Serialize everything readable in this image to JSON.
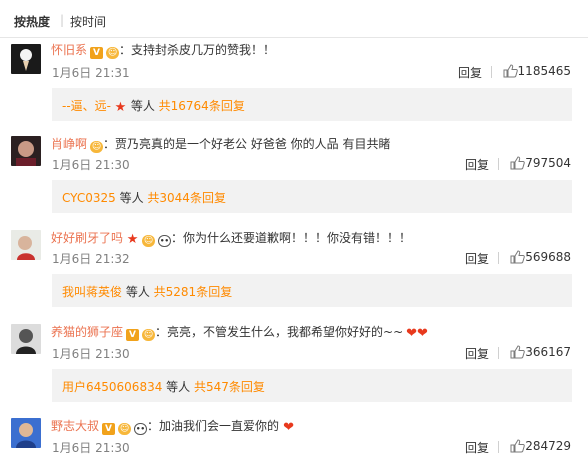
{
  "sort": {
    "hot": "按热度",
    "sep": "|",
    "time": "按时间"
  },
  "comments": [
    {
      "user": "怀旧系",
      "text": "：支持封杀皮几万的赞我！！",
      "time": "1月6日 21:31",
      "reply": "回复",
      "likes": "1185465",
      "sub": {
        "users": "--逼、远-",
        "mid": " 等人 ",
        "total": "共16764条回复"
      }
    },
    {
      "user": "肖峥啊",
      "text": "：贾乃亮真的是一个好老公 好爸爸 你的人品 有目共睹",
      "time": "1月6日 21:30",
      "reply": "回复",
      "likes": "797504",
      "sub": {
        "users": "CYC0325",
        "mid": " 等人 ",
        "total": "共3044条回复"
      }
    },
    {
      "user": "好好刷牙了吗",
      "text": "：你为什么还要道歉啊！！！你没有错！！！",
      "time": "1月6日 21:32",
      "reply": "回复",
      "likes": "569688",
      "sub": {
        "users": "我叫蒋英俊",
        "mid": " 等人 ",
        "total": "共5281条回复"
      }
    },
    {
      "user": "养猫的狮子座",
      "text": "：亮亮，不管发生什么，我都希望你好好的~~",
      "time": "1月6日 21:30",
      "reply": "回复",
      "likes": "366167",
      "sub": {
        "users": "用户6450606834",
        "mid": " 等人 ",
        "total": "共547条回复"
      }
    },
    {
      "user": "野志大叔",
      "text": "：加油我们会一直爱你的",
      "time": "1月6日 21:30",
      "reply": "回复",
      "likes": "284729"
    }
  ],
  "colors": {
    "accent": "#eb7350",
    "sub_link": "#ff8a00",
    "heart": "#e8391d",
    "vip": "#f1a21b"
  },
  "icons": [
    "vip-badge-icon",
    "emoji-face-icon",
    "star-icon",
    "panda-icon",
    "heart-emoji-icon",
    "like-thumb-icon"
  ]
}
